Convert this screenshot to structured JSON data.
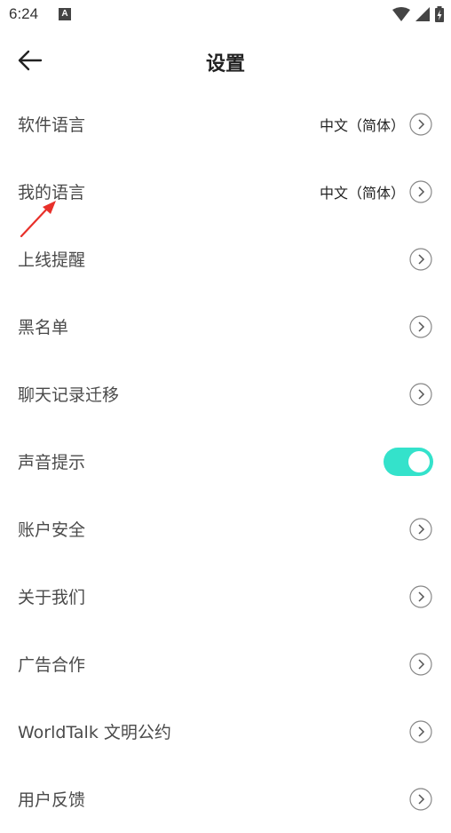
{
  "status_bar": {
    "time": "6:24",
    "notification_icon": "A"
  },
  "header": {
    "title": "设置"
  },
  "settings": {
    "software_language": {
      "label": "软件语言",
      "value": "中文（简体）"
    },
    "my_language": {
      "label": "我的语言",
      "value": "中文（简体）"
    },
    "online_reminder": {
      "label": "上线提醒"
    },
    "blacklist": {
      "label": "黑名单"
    },
    "chat_migration": {
      "label": "聊天记录迁移"
    },
    "sound_prompt": {
      "label": "声音提示",
      "enabled": true
    },
    "account_security": {
      "label": "账户安全"
    },
    "about_us": {
      "label": "关于我们"
    },
    "ad_cooperation": {
      "label": "广告合作"
    },
    "civility_pact": {
      "label": "WorldTalk 文明公约"
    },
    "user_feedback": {
      "label": "用户反馈"
    }
  },
  "colors": {
    "accent": "#34e2cb",
    "annotation": "#e8302a"
  }
}
